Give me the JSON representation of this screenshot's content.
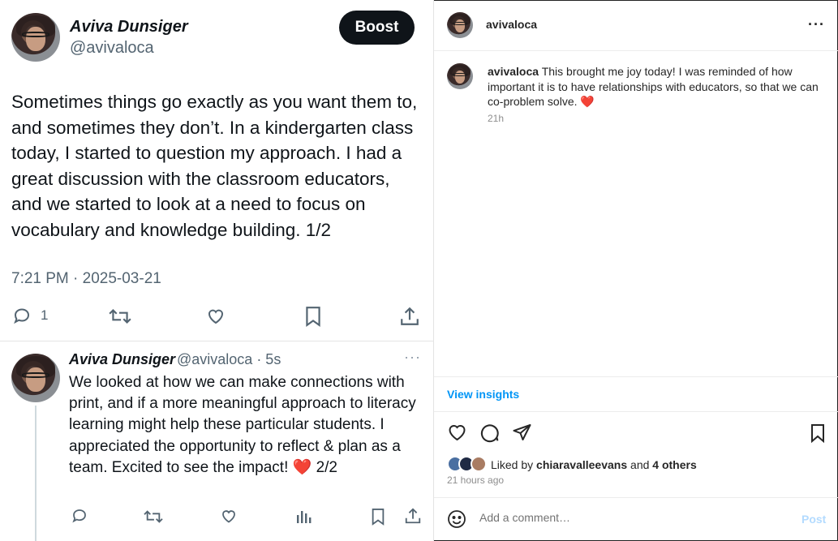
{
  "tweet": {
    "author_name": "Aviva Dunsiger",
    "handle": "@avivaloca",
    "boost_label": "Boost",
    "text": "Sometimes things go exactly as you want them to, and sometimes they don’t. In a kindergarten class today, I started to question my approach. I had a great discussion with the classroom educators, and we started to look at a need to focus on vocabulary and knowledge building. 1/2",
    "timestamp": "7:21 PM · 2025-03-21",
    "reply_count": "1"
  },
  "reply": {
    "author_name": "Aviva Dunsiger",
    "meta": "@avivaloca · 5s",
    "more": "···",
    "text": "We looked at how we can make connections with print, and if a more meaningful approach to literacy learning might help these particular students. I appreciated the opportunity to reflect & plan as a team. Excited to see the impact! ❤️ 2/2"
  },
  "instagram": {
    "username": "avivaloca",
    "more": "···",
    "caption_user": "avivaloca",
    "caption_text": "This brought me joy today! I was reminded of how important it is to have relationships with educators, so that we can co-problem solve. ❤️",
    "caption_time": "21h",
    "insights_label": "View insights",
    "likes_prefix": "Liked by",
    "likes_user": "chiaravalleevans",
    "likes_and": "and",
    "likes_others": "4 others",
    "time_ago": "21 hours ago",
    "comment_placeholder": "Add a comment…",
    "post_label": "Post"
  },
  "colors": {
    "link_blue": "#0095f6",
    "heart_red": "#e0245e",
    "muted": "#536471",
    "boost_bg": "#0f1419"
  },
  "icons": [
    "reply-icon",
    "retweet-icon",
    "like-icon",
    "bookmark-icon",
    "share-icon",
    "analytics-icon",
    "heart-icon",
    "comment-icon",
    "send-icon",
    "save-icon",
    "emoji-icon"
  ]
}
